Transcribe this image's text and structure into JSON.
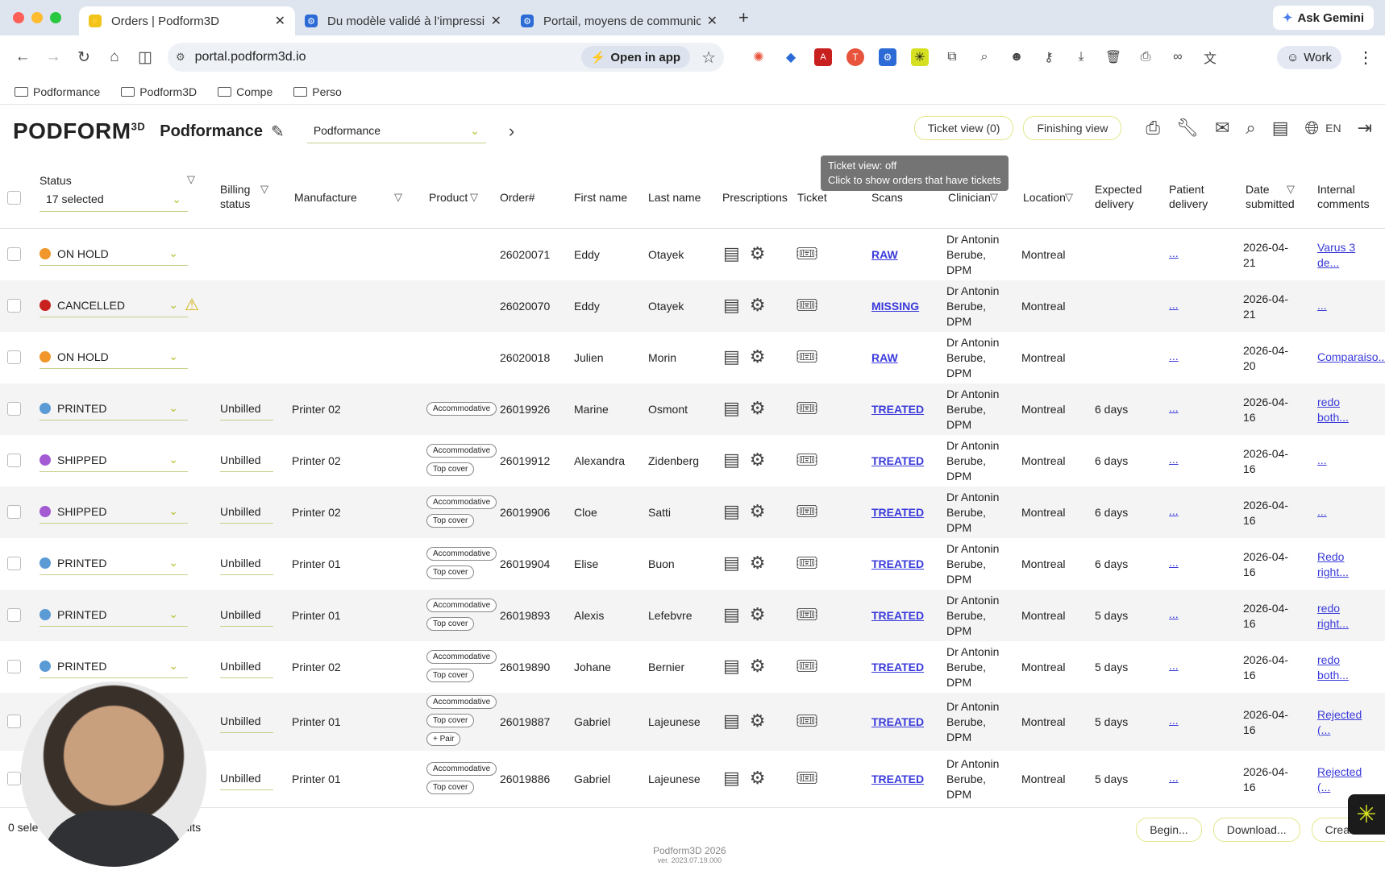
{
  "browser": {
    "tabs": [
      {
        "title": "Orders | Podform3D",
        "active": true,
        "fav_color": "#f0c419"
      },
      {
        "title": "Du modèle validé à l’impressi",
        "active": false,
        "fav_color": "#2c6bd6"
      },
      {
        "title": "Portail, moyens de communic",
        "active": false,
        "fav_color": "#2c6bd6"
      }
    ],
    "ask_gemini": "Ask Gemini",
    "url": "portal.podform3d.io",
    "open_in_app": "Open in app",
    "profile": "Work",
    "bookmarks": [
      "Podformance",
      "Podform3D",
      "Compe",
      "Perso"
    ]
  },
  "header": {
    "logo": "PODFORM",
    "logo_sup": "3D",
    "company": "Podformance",
    "company_select": "Podformance",
    "ticket_view": "Ticket view (0)",
    "finishing_view": "Finishing view",
    "lang": "EN",
    "tooltip_line1": "Ticket view: off",
    "tooltip_line2": "Click to show orders that have tickets"
  },
  "columns": {
    "status": "Status",
    "status_selected": "17 selected",
    "billing1": "Billing",
    "billing2": "status",
    "manufacture": "Manufacture",
    "product": "Product",
    "order": "Order#",
    "first": "First name",
    "last": "Last name",
    "prescriptions": "Prescriptions",
    "ticket": "Ticket",
    "scans": "Scans",
    "clinician": "Clinician",
    "location": "Location",
    "expected1": "Expected",
    "expected2": "delivery",
    "patient1": "Patient",
    "patient2": "delivery",
    "date1": "Date",
    "date2": "submitted",
    "internal1": "Internal",
    "internal2": "comments"
  },
  "rows": [
    {
      "status": "ON HOLD",
      "color": "#f0962a",
      "warn": false,
      "billing": "",
      "manufacture": "",
      "chips": [],
      "order": "26020071",
      "first": "Eddy",
      "last": "Otayek",
      "scan": "RAW",
      "clin1": "Dr Antonin",
      "clin2": "Berube,",
      "clin3": "DPM",
      "location": "Montreal",
      "expected": "",
      "patient": "...",
      "date1": "2026-04-",
      "date2": "21",
      "comment1": "Varus 3",
      "comment2": "de..."
    },
    {
      "status": "CANCELLED",
      "color": "#c8201f",
      "warn": true,
      "billing": "",
      "manufacture": "",
      "chips": [],
      "order": "26020070",
      "first": "Eddy",
      "last": "Otayek",
      "scan": "MISSING",
      "clin1": "Dr Antonin",
      "clin2": "Berube,",
      "clin3": "DPM",
      "location": "Montreal",
      "expected": "",
      "patient": "...",
      "date1": "2026-04-",
      "date2": "21",
      "comment1": "...",
      "comment2": ""
    },
    {
      "status": "ON HOLD",
      "color": "#f0962a",
      "warn": false,
      "billing": "",
      "manufacture": "",
      "chips": [],
      "order": "26020018",
      "first": "Julien",
      "last": "Morin",
      "scan": "RAW",
      "clin1": "Dr Antonin",
      "clin2": "Berube,",
      "clin3": "DPM",
      "location": "Montreal",
      "expected": "",
      "patient": "...",
      "date1": "2026-04-",
      "date2": "20",
      "comment1": "Comparaiso...",
      "comment2": ""
    },
    {
      "status": "PRINTED",
      "color": "#5b9bd5",
      "warn": false,
      "billing": "Unbilled",
      "manufacture": "Printer 02",
      "chips": [
        "Accommodative"
      ],
      "order": "26019926",
      "first": "Marine",
      "last": "Osmont",
      "scan": "TREATED",
      "clin1": "Dr Antonin",
      "clin2": "Berube,",
      "clin3": "DPM",
      "location": "Montreal",
      "expected": "6 days",
      "patient": "...",
      "date1": "2026-04-",
      "date2": "16",
      "comment1": "redo",
      "comment2": "both..."
    },
    {
      "status": "SHIPPED",
      "color": "#a35ad3",
      "warn": false,
      "billing": "Unbilled",
      "manufacture": "Printer 02",
      "chips": [
        "Accommodative",
        "Top cover"
      ],
      "order": "26019912",
      "first": "Alexandra",
      "last": "Zidenberg",
      "scan": "TREATED",
      "clin1": "Dr Antonin",
      "clin2": "Berube,",
      "clin3": "DPM",
      "location": "Montreal",
      "expected": "6 days",
      "patient": "...",
      "date1": "2026-04-",
      "date2": "16",
      "comment1": "...",
      "comment2": ""
    },
    {
      "status": "SHIPPED",
      "color": "#a35ad3",
      "warn": false,
      "billing": "Unbilled",
      "manufacture": "Printer 02",
      "chips": [
        "Accommodative",
        "Top cover"
      ],
      "order": "26019906",
      "first": "Cloe",
      "last": "Satti",
      "scan": "TREATED",
      "clin1": "Dr Antonin",
      "clin2": "Berube,",
      "clin3": "DPM",
      "location": "Montreal",
      "expected": "6 days",
      "patient": "...",
      "date1": "2026-04-",
      "date2": "16",
      "comment1": "...",
      "comment2": ""
    },
    {
      "status": "PRINTED",
      "color": "#5b9bd5",
      "warn": false,
      "billing": "Unbilled",
      "manufacture": "Printer 01",
      "chips": [
        "Accommodative",
        "Top cover"
      ],
      "order": "26019904",
      "first": "Elise",
      "last": "Buon",
      "scan": "TREATED",
      "clin1": "Dr Antonin",
      "clin2": "Berube,",
      "clin3": "DPM",
      "location": "Montreal",
      "expected": "6 days",
      "patient": "...",
      "date1": "2026-04-",
      "date2": "16",
      "comment1": "Redo",
      "comment2": "right..."
    },
    {
      "status": "PRINTED",
      "color": "#5b9bd5",
      "warn": false,
      "billing": "Unbilled",
      "manufacture": "Printer 01",
      "chips": [
        "Accommodative",
        "Top cover"
      ],
      "order": "26019893",
      "first": "Alexis",
      "last": "Lefebvre",
      "scan": "TREATED",
      "clin1": "Dr Antonin",
      "clin2": "Berube,",
      "clin3": "DPM",
      "location": "Montreal",
      "expected": "5 days",
      "patient": "...",
      "date1": "2026-04-",
      "date2": "16",
      "comment1": "redo",
      "comment2": "right..."
    },
    {
      "status": "PRINTED",
      "color": "#5b9bd5",
      "warn": false,
      "billing": "Unbilled",
      "manufacture": "Printer 02",
      "chips": [
        "Accommodative",
        "Top cover"
      ],
      "order": "26019890",
      "first": "Johane",
      "last": "Bernier",
      "scan": "TREATED",
      "clin1": "Dr Antonin",
      "clin2": "Berube,",
      "clin3": "DPM",
      "location": "Montreal",
      "expected": "5 days",
      "patient": "...",
      "date1": "2026-04-",
      "date2": "16",
      "comment1": "redo",
      "comment2": "both..."
    },
    {
      "status": "",
      "color": "",
      "warn": false,
      "billing": "Unbilled",
      "manufacture": "Printer 01",
      "chips": [
        "Accommodative",
        "Top cover",
        "+ Pair"
      ],
      "order": "26019887",
      "first": "Gabriel",
      "last": "Lajeunese",
      "scan": "TREATED",
      "clin1": "Dr Antonin",
      "clin2": "Berube,",
      "clin3": "DPM",
      "location": "Montreal",
      "expected": "5 days",
      "patient": "...",
      "date1": "2026-04-",
      "date2": "16",
      "comment1": "Rejected",
      "comment2": "(..."
    },
    {
      "status": "",
      "color": "",
      "warn": false,
      "billing": "Unbilled",
      "manufacture": "Printer 01",
      "chips": [
        "Accommodative",
        "Top cover"
      ],
      "order": "26019886",
      "first": "Gabriel",
      "last": "Lajeunese",
      "scan": "TREATED",
      "clin1": "Dr Antonin",
      "clin2": "Berube,",
      "clin3": "DPM",
      "location": "Montreal",
      "expected": "5 days",
      "patient": "...",
      "date1": "2026-04-",
      "date2": "16",
      "comment1": "Rejected",
      "comment2": "(..."
    }
  ],
  "footer": {
    "selected_left": "0 sele",
    "selected_right": "ults",
    "begin": "Begin...",
    "download": "Download...",
    "create": "Create or",
    "copyright": "Podform3D 2026",
    "version": "ver. 2023.07.19.000"
  }
}
